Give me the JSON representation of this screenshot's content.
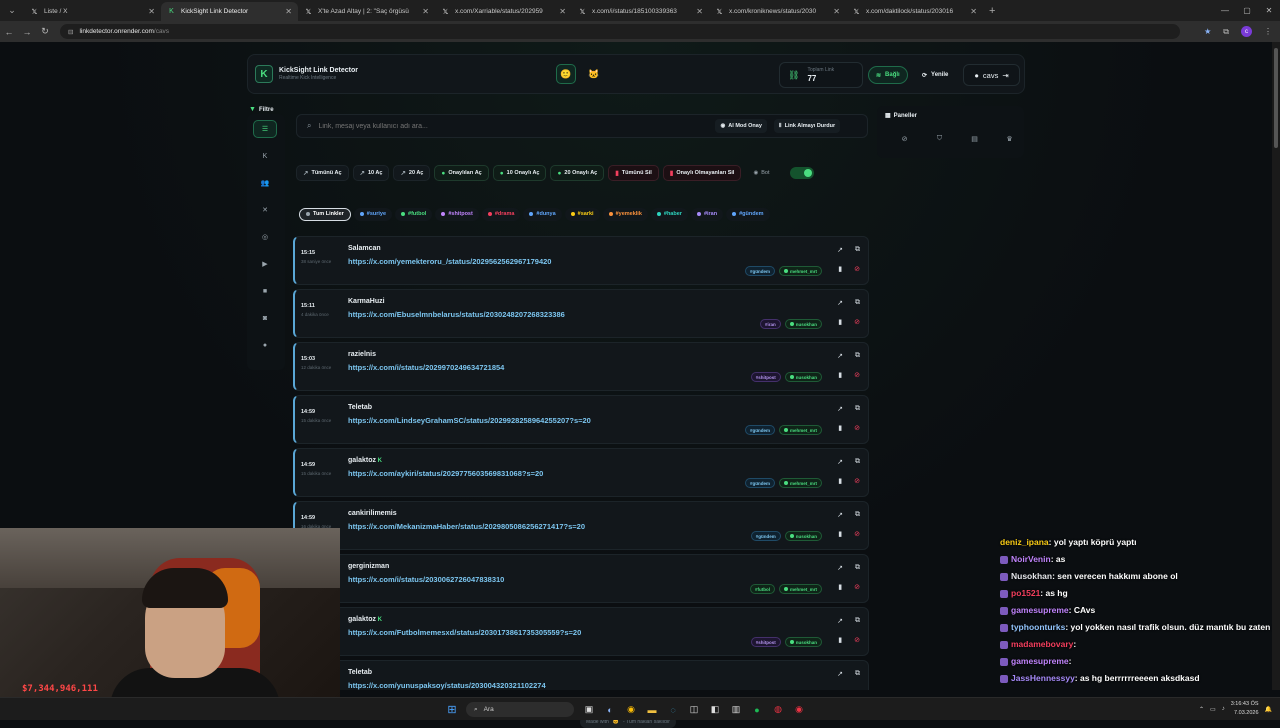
{
  "browser": {
    "tabs": [
      {
        "label": "Liste / X",
        "icon": "x"
      },
      {
        "label": "KickSight Link Detector",
        "icon": "k",
        "active": true
      },
      {
        "label": "X'te Azad Altay | 2: \"Saç örgüsü",
        "icon": "x"
      },
      {
        "label": "x.com/Xarriable/status/202959",
        "icon": "x"
      },
      {
        "label": "x.com/i/status/185100339363",
        "icon": "x"
      },
      {
        "label": "x.com/kroniknews/status/2030",
        "icon": "x"
      },
      {
        "label": "x.com/daktilock/status/203016",
        "icon": "x"
      }
    ],
    "url_host": "linkdetector.onrender.com",
    "url_path": "/cavs",
    "profile_initial": "c"
  },
  "header": {
    "title": "KickSight Link Detector",
    "subtitle": "Realtime Kick Intelligence",
    "stat_label": "Toplam Link",
    "stat_value": "77",
    "connected_label": "Bağlı",
    "refresh_label": "Yenile",
    "username": "cavs"
  },
  "sidebar": {
    "title": "Filtre",
    "items": [
      {
        "icon": "list-icon",
        "glyph": "☰",
        "active": true
      },
      {
        "icon": "kick-icon",
        "glyph": "K"
      },
      {
        "icon": "users-icon",
        "glyph": "👥"
      },
      {
        "icon": "x-icon",
        "glyph": "✕"
      },
      {
        "icon": "instagram-icon",
        "glyph": "◎"
      },
      {
        "icon": "youtube-icon",
        "glyph": "▶"
      },
      {
        "icon": "video-icon",
        "glyph": "■"
      },
      {
        "icon": "camera-icon",
        "glyph": "◙"
      },
      {
        "icon": "globe-icon",
        "glyph": "●"
      }
    ]
  },
  "search": {
    "placeholder": "Link, mesaj veya kullanıcı adı ara...",
    "ai_mode": "AI Mod Onay",
    "stop_link": "Link Almayı Durdur"
  },
  "actions": {
    "open_all": "Tümünü Aç",
    "open_10": "10 Aç",
    "open_20": "20 Aç",
    "open_approved": "Onaylıları Aç",
    "open_10_approved": "10 Onaylı Aç",
    "open_20_approved": "20 Onaylı Aç",
    "delete_all": "Tümünü Sil",
    "delete_unapproved": "Onaylı Olmayanları Sil",
    "bot": "Bot"
  },
  "tags": [
    {
      "label": "Tum Linkler",
      "color": "#9aa5ad",
      "active": true
    },
    {
      "label": "#suriye",
      "color": "#60a5fa"
    },
    {
      "label": "#futbol",
      "color": "#4ade80"
    },
    {
      "label": "#shitpost",
      "color": "#c084fc"
    },
    {
      "label": "#drama",
      "color": "#f43f5e"
    },
    {
      "label": "#dunya",
      "color": "#60a5fa"
    },
    {
      "label": "#sarki",
      "color": "#facc15"
    },
    {
      "label": "#yemeklik",
      "color": "#fb923c"
    },
    {
      "label": "#haber",
      "color": "#2dd4bf"
    },
    {
      "label": "#iran",
      "color": "#a78bfa"
    },
    {
      "label": "#gündem",
      "color": "#60a5fa"
    }
  ],
  "feed": [
    {
      "time": "15:15",
      "ago": "38 saniye önce",
      "user": "Salamcan",
      "kick": false,
      "link": "https://x.com/yemekteroru_/status/2029562562967179420",
      "topic": "#gündem",
      "topic_class": "",
      "user_badge": "mehmet_mrt"
    },
    {
      "time": "15:11",
      "ago": "4 dakika önce",
      "user": "KarmaHuzi",
      "kick": false,
      "link": "https://x.com/Ebuselmnbelarus/status/2030248207268323386",
      "topic": "#iran",
      "topic_class": "purple",
      "user_badge": "nusokhan"
    },
    {
      "time": "15:03",
      "ago": "12 dakika önce",
      "user": "razielnis",
      "kick": false,
      "link": "https://x.com/i/status/2029970249634721854",
      "topic": "#shitpost",
      "topic_class": "purple",
      "user_badge": "nusokhan"
    },
    {
      "time": "14:59",
      "ago": "15 dakika önce",
      "user": "Teletab",
      "kick": false,
      "link": "https://x.com/LindseyGrahamSC/status/2029928258964255207?s=20",
      "topic": "#gündem",
      "topic_class": "",
      "user_badge": "mehmet_mrt"
    },
    {
      "time": "14:59",
      "ago": "15 dakika önce",
      "user": "galaktoz",
      "kick": true,
      "link": "https://x.com/aykiri/status/2029775603569831068?s=20",
      "topic": "#gündem",
      "topic_class": "",
      "user_badge": "mehmet_mrt"
    },
    {
      "time": "14:59",
      "ago": "16 dakika önce",
      "user": "cankirilimemis",
      "kick": false,
      "link": "https://x.com/MekanizmaHaber/status/2029805086256271417?s=20",
      "topic": "#gündem",
      "topic_class": "",
      "user_badge": "nusokhan"
    },
    {
      "time": "",
      "ago": "",
      "user": "gerginizman",
      "kick": false,
      "link": "https://x.com/i/status/2030062726047838310",
      "topic": "#futbol",
      "topic_class": "green",
      "user_badge": "mehmet_mrt"
    },
    {
      "time": "",
      "ago": "",
      "user": "galaktoz",
      "kick": true,
      "link": "https://x.com/Futbolmemesxd/status/2030173861735305559?s=20",
      "topic": "#shitpost",
      "topic_class": "purple",
      "user_badge": "nusokhan"
    },
    {
      "time": "",
      "ago": "",
      "user": "Teletab",
      "kick": false,
      "link": "https://x.com/yunuspaksoy/status/203004320321102274",
      "topic": "",
      "topic_class": "",
      "user_badge": ""
    }
  ],
  "panels": {
    "title": "Paneller"
  },
  "footer": {
    "made_with": "Made with",
    "rights": "- Tüm hakları saklıdır"
  },
  "chat": [
    {
      "name": "deniz_ipana",
      "color": "#facc15",
      "text": ": yol yaptı köprü yaptı"
    },
    {
      "name": "NoirVenin",
      "color": "#c084fc",
      "text": ": as"
    },
    {
      "name": "Nusokhan",
      "color": "#e5e7eb",
      "text": ": sen verecen hakkımı abone ol"
    },
    {
      "name": "po1521",
      "color": "#f43f5e",
      "text": ": as hg"
    },
    {
      "name": "gamesupreme",
      "color": "#c084fc",
      "text": ": CAvs"
    },
    {
      "name": "typhoonturks",
      "color": "#93c5fd",
      "text": ": yol yokken nasıl trafik olsun. düz mantık bu zaten"
    },
    {
      "name": "madamebovary",
      "color": "#f43f5e",
      "text": ":"
    },
    {
      "name": "gamesupreme",
      "color": "#c084fc",
      "text": ":"
    },
    {
      "name": "JassHennessyy",
      "color": "#a78bfa",
      "text": ": as hg berrrrrreeeen aksdkasd"
    }
  ],
  "webcam": {
    "money": "$7,344,946,111"
  },
  "taskbar": {
    "search": "Ara",
    "time": "3:16:43 ÖS",
    "date": "7.03.2026"
  }
}
